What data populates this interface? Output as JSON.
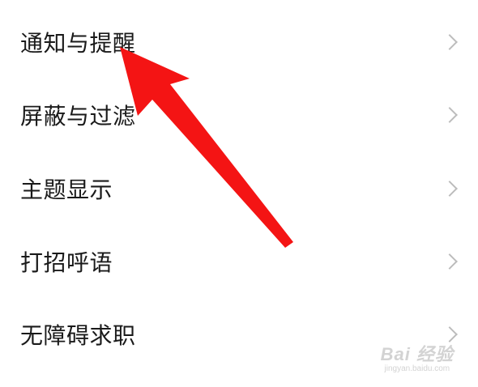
{
  "settings": {
    "items": [
      {
        "label": "通知与提醒",
        "icon": "chevron-right-icon"
      },
      {
        "label": "屏蔽与过滤",
        "icon": "chevron-right-icon"
      },
      {
        "label": "主题显示",
        "icon": "chevron-right-icon"
      },
      {
        "label": "打招呼语",
        "icon": "chevron-right-icon"
      },
      {
        "label": "无障碍求职",
        "icon": "chevron-right-icon"
      }
    ]
  },
  "annotation": {
    "icon": "red-arrow-icon",
    "color": "#f41414",
    "points_to": "通知与提醒"
  },
  "watermark": {
    "main": "Bai 经验",
    "sub": "jingyan.baidu.com"
  },
  "colors": {
    "background": "#ffffff",
    "text": "#1a1a1a",
    "chevron": "#bcbcbc",
    "watermark": "#d3d3d3"
  }
}
